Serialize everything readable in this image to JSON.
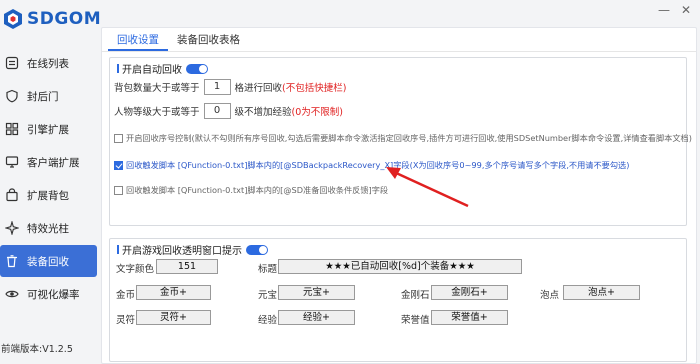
{
  "app": {
    "brand": "SDGOM",
    "version": "前端版本:V1.2.5"
  },
  "window_controls": {
    "minimize": "—",
    "close": "✕"
  },
  "sidebar": {
    "items": [
      {
        "label": "在线列表",
        "icon": "list-icon"
      },
      {
        "label": "封后门",
        "icon": "shield-icon"
      },
      {
        "label": "引擎扩展",
        "icon": "extension-icon"
      },
      {
        "label": "客户端扩展",
        "icon": "monitor-icon"
      },
      {
        "label": "扩展背包",
        "icon": "bag-icon"
      },
      {
        "label": "特效光柱",
        "icon": "sparkle-icon"
      },
      {
        "label": "装备回收",
        "icon": "recycle-icon",
        "active": true
      },
      {
        "label": "可视化爆率",
        "icon": "eye-icon"
      }
    ]
  },
  "tabs": [
    {
      "label": "回收设置",
      "active": true
    },
    {
      "label": "装备回收表格",
      "active": false
    }
  ],
  "auto_recycle": {
    "header": "开启自动回收",
    "enabled": true,
    "bag_row": {
      "prefix": "背包数量大于或等于",
      "value": "1",
      "suffix": "格进行回收",
      "note": "(不包括快捷栏)"
    },
    "level_row": {
      "prefix": "人物等级大于或等于",
      "value": "0",
      "suffix": "级不增加经验",
      "note": "(0为不限制)"
    },
    "option1": {
      "checked": false,
      "text": "开启回收序号控制(默认不勾则所有序号回收,勾选后需要脚本命令激活指定回收序号,插件方可进行回收,使用SDSetNumber脚本命令设置,详情查看脚本文档)"
    },
    "option2": {
      "checked": true,
      "text": "回收触发脚本 [QFunction-0.txt]脚本内的[@SDBackpackRecovery_X]字段(X为回收序号0~99,多个序号请写多个字段,不用请不要勾选)"
    },
    "option3": {
      "checked": false,
      "text": "回收触发脚本 [QFunction-0.txt]脚本内的[@SD准备回收条件反馈]字段"
    }
  },
  "tip_window": {
    "header": "开启游戏回收透明窗口提示",
    "enabled": true,
    "text_color": {
      "label": "文字颜色",
      "value": "151"
    },
    "title": {
      "label": "标题",
      "value": "★★★已自动回收[%d]个装备★★★"
    },
    "items": [
      {
        "label": "金币",
        "value": "金币+"
      },
      {
        "label": "元宝",
        "value": "元宝+"
      },
      {
        "label": "金刚石",
        "value": "金刚石+"
      },
      {
        "label": "泡点",
        "value": "泡点+"
      },
      {
        "label": "灵符",
        "value": "灵符+"
      },
      {
        "label": "经验",
        "value": "经验+"
      },
      {
        "label": "荣誉值",
        "value": "荣誉值+"
      }
    ]
  },
  "colors": {
    "accent": "#2c6ae0",
    "sidebar_active": "#3b6fd6",
    "warning_red": "#e02020",
    "annotation_arrow": "#e02020"
  }
}
